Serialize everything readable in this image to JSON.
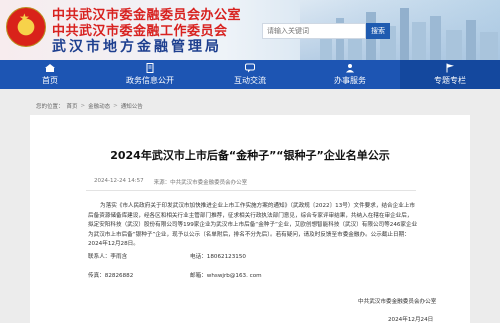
{
  "header": {
    "line1": "中共武汉市委金融委员会办公室",
    "line2": "中共武汉市委金融工作委员会",
    "line3": "武汉市地方金融管理局",
    "search_placeholder": "请输入关键词",
    "search_button": "搜索"
  },
  "nav": {
    "items": [
      {
        "label": "首页",
        "icon": "home-icon"
      },
      {
        "label": "政务信息公开",
        "icon": "document-icon"
      },
      {
        "label": "互动交流",
        "icon": "chat-icon"
      },
      {
        "label": "办事服务",
        "icon": "people-icon"
      },
      {
        "label": "专题专栏",
        "icon": "flag-icon"
      }
    ],
    "active_index": 4,
    "bg_color": "#1d55b3"
  },
  "breadcrumb": {
    "location": "您的位置：",
    "items": [
      "首页",
      "金融动态",
      "通知公告"
    ]
  },
  "article": {
    "title": "2024年武汉市上市后备“金种子”“银种子”企业名单公示",
    "date": "2024-12-24 14:57",
    "source_label": "来源：",
    "source": "中共武汉市委金融委员会办公室",
    "paragraph": "为落实《市人民政府关于印发武汉市加快推进企业上市工作实施方案的通知》（武政规〔2022〕13号）文件要求，结合企业上市后备资源储备库建设，经各区和相关行业主管部门推荐，征求相关行政执法部门意见，综合专家评审结果，共纳入在辖在审企业后，拟定安阳科技（武汉）股份有限公司等199家企业为武汉市上市后备“金种子”企业，艾欧创想智能科技（武汉）有限公司等246家企业为武汉市上市后备“银种子”企业，现予以公示（名单附后，排名不分先后）。若有疑问，请及时反馈至市委金融办。公示截止日期：2024年12月28日。",
    "contact_name_label": "联系人：",
    "contact_name": "李雨含",
    "phone_label": "电话：",
    "phone": "18062123150",
    "fax_label": "传真：",
    "fax": "82826882",
    "email_label": "邮箱：",
    "email": "whswjrb@163. com",
    "signature_org": "中共武汉市委金融委员会办公室",
    "signature_date": "2024年12月24日"
  }
}
